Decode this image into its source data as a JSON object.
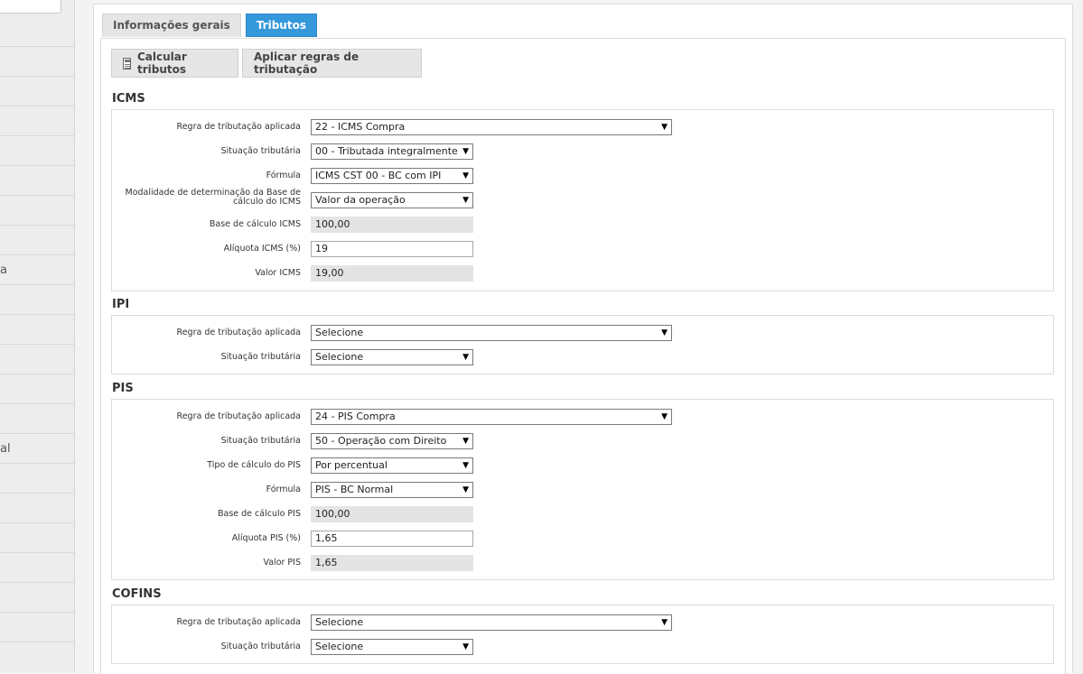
{
  "sidebar": {
    "items": [
      "a",
      "al"
    ]
  },
  "tabs": [
    {
      "label": "Informações gerais",
      "active": false
    },
    {
      "label": "Tributos",
      "active": true
    }
  ],
  "toolbar": {
    "calc_label": "Calcular tributos",
    "rules_label": "Aplicar regras de tributação"
  },
  "icms": {
    "title": "ICMS",
    "rule_label": "Regra de tributação aplicada",
    "rule_value": "22 - ICMS Compra",
    "situation_label": "Situação tributária",
    "situation_value": "00 - Tributada integralmente",
    "formula_label": "Fórmula",
    "formula_value": "ICMS CST 00 - BC com IPI",
    "modality_label": "Modalidade de determinação da Base de cálculo do ICMS",
    "modality_value": "Valor da operação",
    "base_label": "Base de cálculo ICMS",
    "base_value": "100,00",
    "rate_label": "Alíquota ICMS (%)",
    "rate_value": "19",
    "value_label": "Valor ICMS",
    "value_value": "19,00"
  },
  "ipi": {
    "title": "IPI",
    "rule_label": "Regra de tributação aplicada",
    "rule_value": "Selecione",
    "situation_label": "Situação tributária",
    "situation_value": "Selecione"
  },
  "pis": {
    "title": "PIS",
    "rule_label": "Regra de tributação aplicada",
    "rule_value": "24 - PIS Compra",
    "situation_label": "Situação tributária",
    "situation_value": "50 - Operação com Direito",
    "calc_type_label": "Tipo de cálculo do PIS",
    "calc_type_value": "Por percentual",
    "formula_label": "Fórmula",
    "formula_value": "PIS - BC Normal",
    "base_label": "Base de cálculo PIS",
    "base_value": "100,00",
    "rate_label": "Alíquota PIS (%)",
    "rate_value": "1,65",
    "value_label": "Valor PIS",
    "value_value": "1,65"
  },
  "cofins": {
    "title": "COFINS",
    "rule_label": "Regra de tributação aplicada",
    "rule_value": "Selecione",
    "situation_label": "Situação tributária",
    "situation_value": "Selecione"
  }
}
